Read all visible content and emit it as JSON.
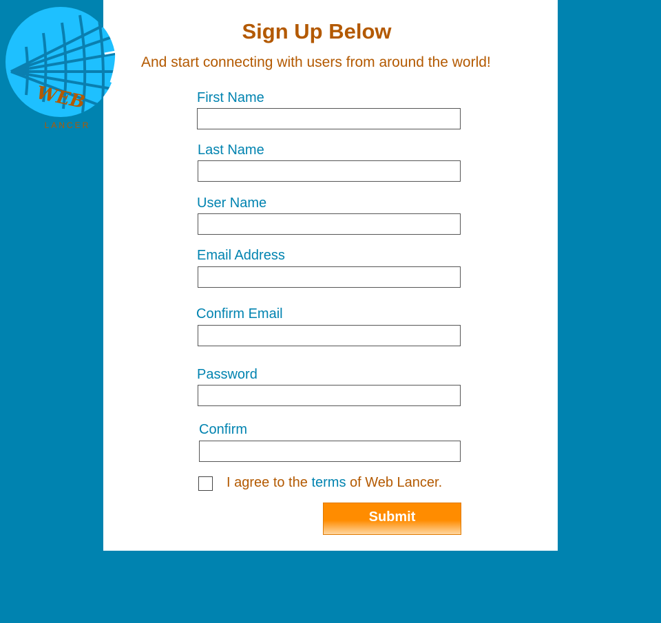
{
  "logo": {
    "word": "WEB",
    "subword": "LANCER",
    "globe_color": "#1ec0ff",
    "text_color": "#b35900"
  },
  "heading": "Sign Up Below",
  "subheading": "And start connecting with users from around the world!",
  "fields": [
    {
      "label": "First Name",
      "value": ""
    },
    {
      "label": "Last Name",
      "value": ""
    },
    {
      "label": "User Name",
      "value": ""
    },
    {
      "label": "Email Address",
      "value": ""
    },
    {
      "label": "Confirm Email",
      "value": ""
    },
    {
      "label": "Password",
      "value": ""
    },
    {
      "label": "Confirm",
      "value": ""
    }
  ],
  "agree": {
    "prefix": "I agree to the",
    "link": "terms",
    "suffix": "of Web Lancer.",
    "checked": false
  },
  "submit_label": "Submit",
  "colors": {
    "background": "#0083b0",
    "panel": "#ffffff",
    "label": "#0083b0",
    "heading": "#b35900",
    "button": "#ff8c00"
  }
}
